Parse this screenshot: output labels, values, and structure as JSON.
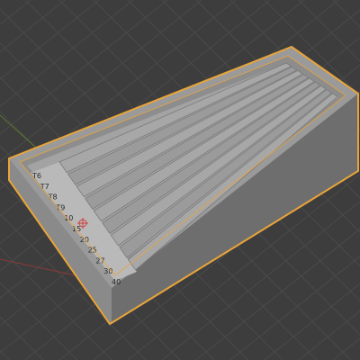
{
  "viewport": {
    "background": "#3d3d3d",
    "grid_color": "#4a4a4a",
    "axis_x_color": "#8a3a3a",
    "axis_y_color": "#5b7a2a"
  },
  "object": {
    "selected": true,
    "outline_color": "#e8a43a",
    "body_color": "#8c8c8c",
    "floor_color": "#a8a8a8",
    "channel_count": 9
  },
  "scale_labels": [
    "T6",
    "T7",
    "T8",
    "T9",
    "10",
    "15",
    "20",
    "25",
    "27",
    "30",
    "40"
  ]
}
